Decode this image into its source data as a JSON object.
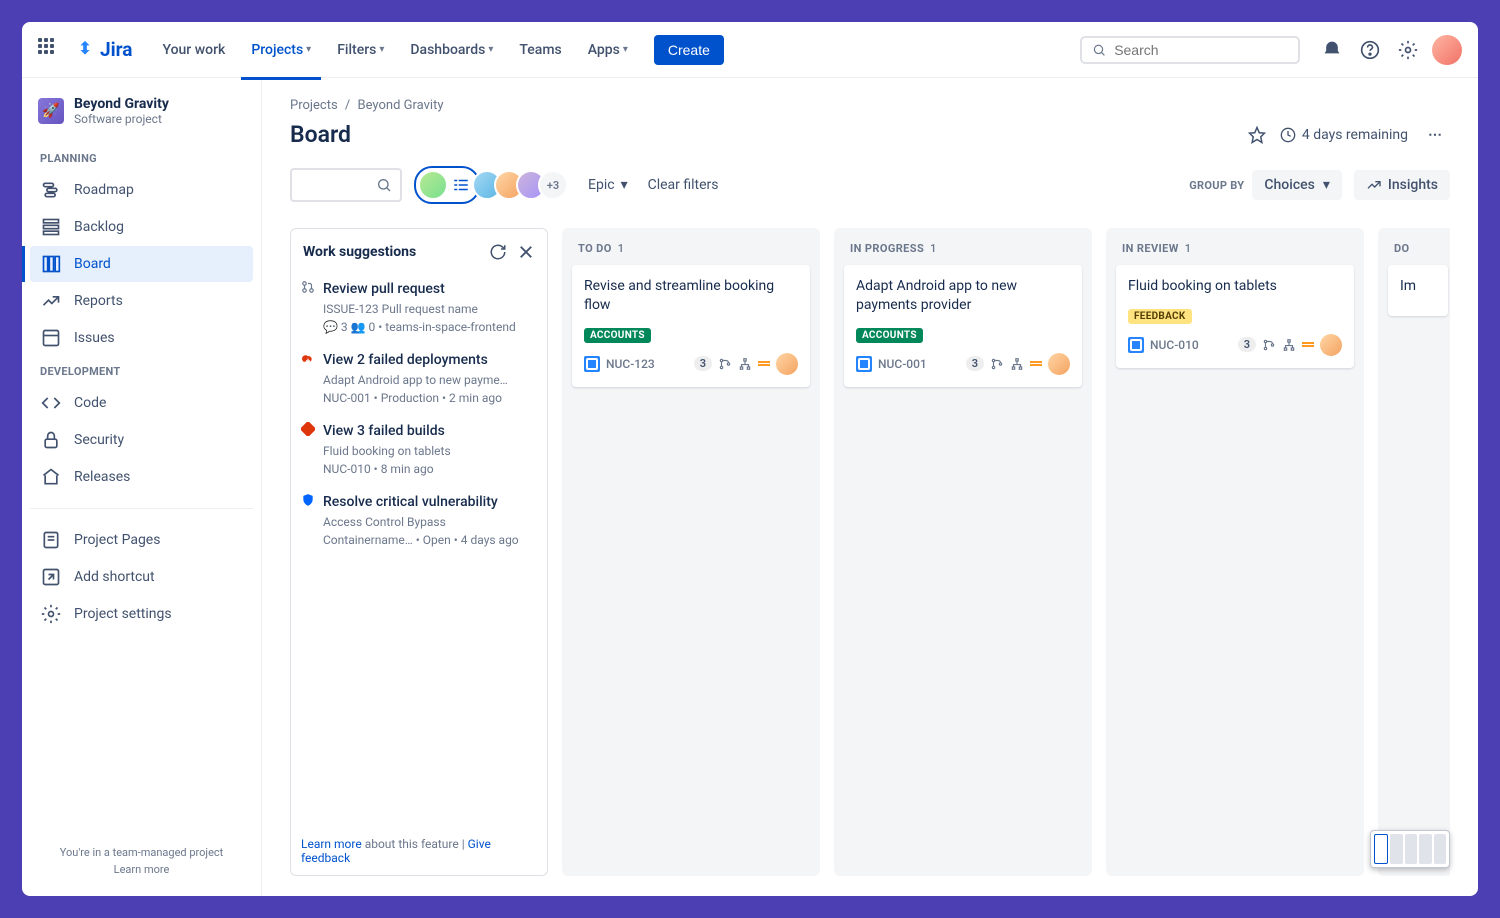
{
  "topnav": {
    "logo": "Jira",
    "items": [
      {
        "label": "Your work",
        "active": false,
        "chevron": false
      },
      {
        "label": "Projects",
        "active": true,
        "chevron": true
      },
      {
        "label": "Filters",
        "active": false,
        "chevron": true
      },
      {
        "label": "Dashboards",
        "active": false,
        "chevron": true
      },
      {
        "label": "Teams",
        "active": false,
        "chevron": false
      },
      {
        "label": "Apps",
        "active": false,
        "chevron": true
      }
    ],
    "create": "Create",
    "search_placeholder": "Search"
  },
  "project": {
    "name": "Beyond Gravity",
    "subtitle": "Software project",
    "icon": "🚀"
  },
  "sidebar": {
    "sections": [
      {
        "label": "PLANNING",
        "items": [
          {
            "label": "Roadmap",
            "icon": "roadmap"
          },
          {
            "label": "Backlog",
            "icon": "backlog"
          },
          {
            "label": "Board",
            "icon": "board",
            "active": true
          },
          {
            "label": "Reports",
            "icon": "reports"
          },
          {
            "label": "Issues",
            "icon": "issues"
          }
        ]
      },
      {
        "label": "DEVELOPMENT",
        "items": [
          {
            "label": "Code",
            "icon": "code"
          },
          {
            "label": "Security",
            "icon": "security"
          },
          {
            "label": "Releases",
            "icon": "releases"
          }
        ]
      }
    ],
    "bottom": [
      {
        "label": "Project Pages",
        "icon": "pages"
      },
      {
        "label": "Add shortcut",
        "icon": "shortcut"
      },
      {
        "label": "Project settings",
        "icon": "gear"
      }
    ],
    "footer": {
      "line1": "You're in a team-managed project",
      "line2": "Learn more"
    }
  },
  "breadcrumb": {
    "root": "Projects",
    "current": "Beyond Gravity"
  },
  "page_title": "Board",
  "remaining": "4 days remaining",
  "toolbar": {
    "avatars_more": "+3",
    "epic": "Epic",
    "clear": "Clear filters",
    "groupby_label": "GROUP BY",
    "groupby_value": "Choices",
    "insights": "Insights"
  },
  "work_suggestions": {
    "title": "Work suggestions",
    "items": [
      {
        "icon": "pr",
        "color": "#6b778c",
        "title": "Review pull request",
        "meta1": "ISSUE-123 Pull request name",
        "meta2": "💬 3  👥 0  •  teams-in-space-frontend"
      },
      {
        "icon": "deploy",
        "color": "#de350b",
        "title": "View 2 failed deployments",
        "meta1": "Adapt Android app to new payme…",
        "meta2": "NUC-001  •  Production  •  2 min ago"
      },
      {
        "icon": "build",
        "color": "#de350b",
        "title": "View 3 failed builds",
        "meta1": "Fluid booking on tablets",
        "meta2": "NUC-010  •  8 min ago"
      },
      {
        "icon": "shield",
        "color": "#0065ff",
        "title": "Resolve critical vulnerability",
        "meta1": "Access Control Bypass",
        "meta2": "Containername…  •  Open  •  4 days ago"
      }
    ],
    "learn_more": "Learn more",
    "about": " about this feature | ",
    "feedback": "Give feedback"
  },
  "columns": [
    {
      "name": "TO DO",
      "count": "1",
      "cards": [
        {
          "title": "Revise and streamline booking flow",
          "tag": {
            "text": "ACCOUNTS",
            "cls": "green"
          },
          "key": "NUC-123",
          "num": "3"
        }
      ]
    },
    {
      "name": "IN PROGRESS",
      "count": "1",
      "cards": [
        {
          "title": "Adapt Android app to new payments provider",
          "tag": {
            "text": "ACCOUNTS",
            "cls": "green"
          },
          "key": "NUC-001",
          "num": "3"
        }
      ]
    },
    {
      "name": "IN REVIEW",
      "count": "1",
      "cards": [
        {
          "title": "Fluid booking on tablets",
          "tag": {
            "text": "FEEDBACK",
            "cls": "yellow"
          },
          "key": "NUC-010",
          "num": "3"
        }
      ]
    },
    {
      "name": "DO",
      "count": "",
      "cards": [
        {
          "title": "Im",
          "tag": null,
          "key": "",
          "num": ""
        }
      ]
    }
  ]
}
